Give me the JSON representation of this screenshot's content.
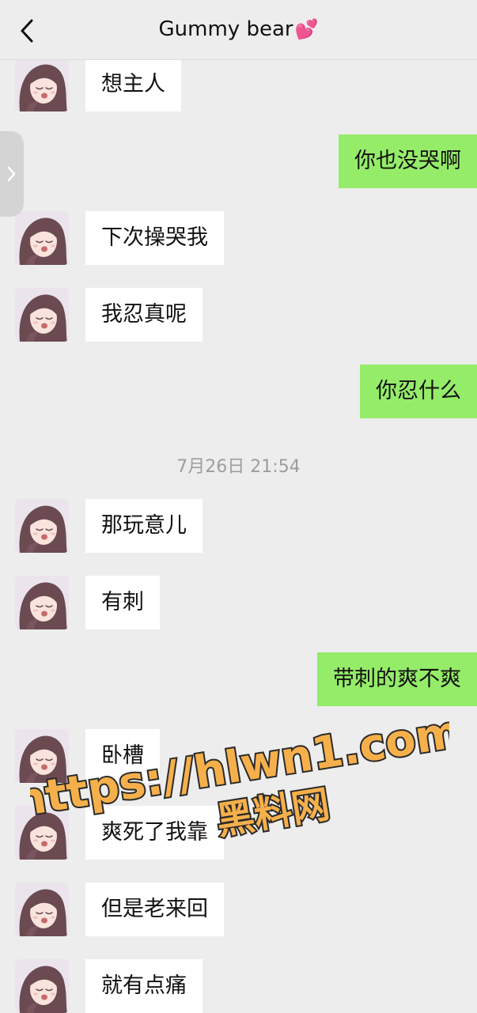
{
  "header": {
    "title": "Gummy bear",
    "title_emoji": "💕"
  },
  "drawer": {
    "icon": "chevron-right-icon"
  },
  "messages": [
    {
      "side": "left",
      "text": "想主人",
      "avatar": "anime-girl-avatar"
    },
    {
      "side": "right",
      "text": "你也没哭啊"
    },
    {
      "side": "left",
      "text": "下次操哭我",
      "avatar": "anime-girl-avatar"
    },
    {
      "side": "left",
      "text": "我忍真呢",
      "avatar": "anime-girl-avatar"
    },
    {
      "side": "right",
      "text": "你忍什么"
    },
    {
      "side": "left",
      "text": "那玩意儿",
      "avatar": "anime-girl-avatar"
    },
    {
      "side": "left",
      "text": "有刺",
      "avatar": "anime-girl-avatar"
    },
    {
      "side": "right",
      "text": "带刺的爽不爽"
    },
    {
      "side": "left",
      "text": "卧槽",
      "avatar": "anime-girl-avatar"
    },
    {
      "side": "left",
      "text": "爽死了我靠",
      "avatar": "anime-girl-avatar"
    },
    {
      "side": "left",
      "text": "但是老来回",
      "avatar": "anime-girl-avatar"
    },
    {
      "side": "left",
      "text": "就有点痛",
      "avatar": "anime-girl-avatar"
    }
  ],
  "timestamp": "7月26日 21:54",
  "watermark": {
    "line1": "https://hlwn1.com",
    "line2": "黑料网"
  },
  "colors": {
    "background": "#ededed",
    "outgoing_bubble": "#95ec69",
    "incoming_bubble": "#ffffff",
    "timestamp": "#9d9d9d",
    "watermark_fill": "#f6b04b"
  }
}
